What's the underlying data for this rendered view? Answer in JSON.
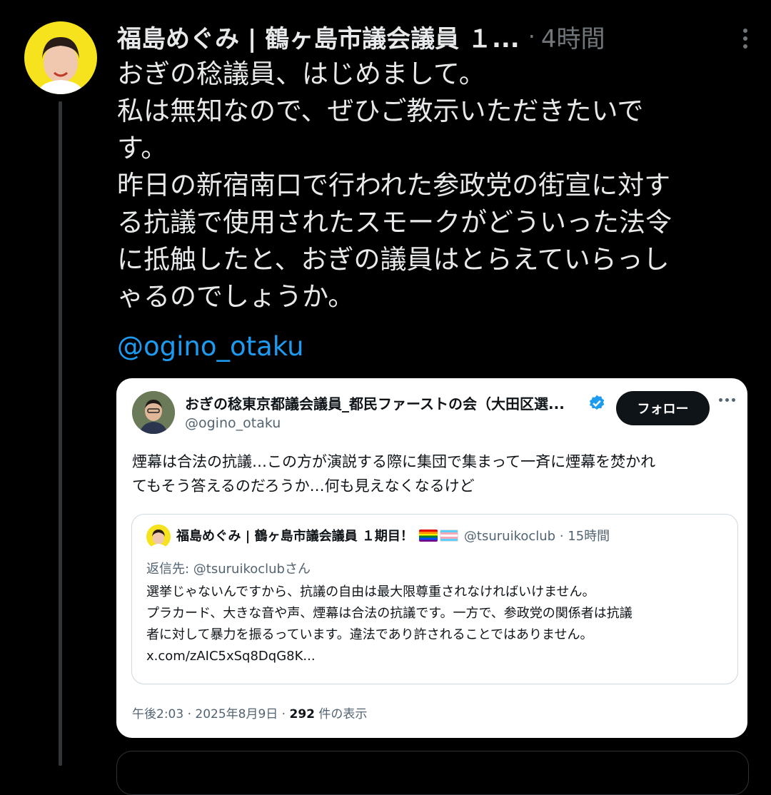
{
  "tweet": {
    "author_name": "福島めぐみ | 鶴ヶ島市議会議員 １...",
    "time": "4時間",
    "text_lines": [
      "おぎの稔議員、はじめまして。",
      "私は無知なので、ぜひご教示いただきたいで",
      "す。",
      "昨日の新宿南口で行われた参政党の街宣に対す",
      "る抗議で使用されたスモークがどういった法令",
      "に抵触したと、おぎの議員はとらえていらっし",
      "ゃるのでしょうか。"
    ],
    "mention": "@ogino_otaku"
  },
  "embedded": {
    "author_name": "おぎの稔東京都議会議員_都民ファーストの会（大田区選...",
    "handle": "@ogino_otaku",
    "follow_label": "フォロー",
    "text_lines": [
      "煙幕は合法の抗議…この方が演説する際に集団で集まって一斉に煙幕を焚かれ",
      "てもそう答えるのだろうか…何も見えなくなるけど"
    ],
    "quote": {
      "author_name": "福島めぐみ | 鶴ヶ島市議会議員 １期目！",
      "handle_time": "@tsuruikoclub · 15時間",
      "reply_to": "返信先: @tsuruikoclubさん",
      "text_lines": [
        "選挙じゃないんですから、抗議の自由は最大限尊重されなければいけません。",
        "プラカード、大きな音や声、煙幕は合法の抗議です。一方で、参政党の関係者は抗議",
        "者に対して暴力を振るっています。違法であり許されることではありません。",
        "x.com/zAIC5xSq8DqG8K..."
      ]
    },
    "meta_time": "午後2:03 · 2025年8月9日 · ",
    "view_count": "292",
    "view_label": " 件の表示"
  },
  "colors": {
    "background": "#000000",
    "text": "#e7e9ea",
    "muted": "#71767b",
    "link": "#1d9bf0",
    "verified": "#1d9bf0",
    "avatar_bg": "#f6e21d"
  },
  "icons": [
    "avatar",
    "more-icon",
    "verified-badge-icon",
    "rainbow-flag-icon",
    "trans-flag-icon"
  ]
}
